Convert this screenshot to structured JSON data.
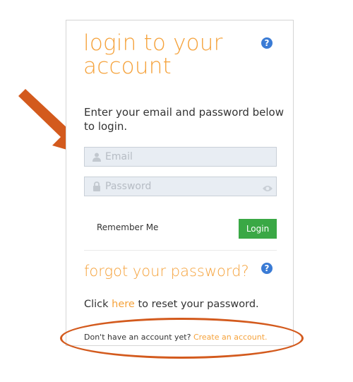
{
  "login": {
    "title": "login to your account",
    "intro": "Enter your email and password below to login.",
    "email_placeholder": "Email",
    "password_placeholder": "Password",
    "remember_label": "Remember Me",
    "login_button": "Login"
  },
  "forgot": {
    "title": "forgot your password?",
    "reset_prefix": "Click",
    "reset_link": "here",
    "reset_suffix": "to reset your password."
  },
  "signup": {
    "prompt": "Don't have an account yet?",
    "link": "Create an account."
  },
  "icons": {
    "help": "question-mark-circle-icon",
    "user": "user-icon",
    "lock": "lock-icon",
    "eye": "eye-icon"
  },
  "colors": {
    "accent_orange": "#f5a23b",
    "login_green": "#3aa845",
    "help_blue": "#3a7bd5",
    "annotation_red": "#d35a1d"
  }
}
